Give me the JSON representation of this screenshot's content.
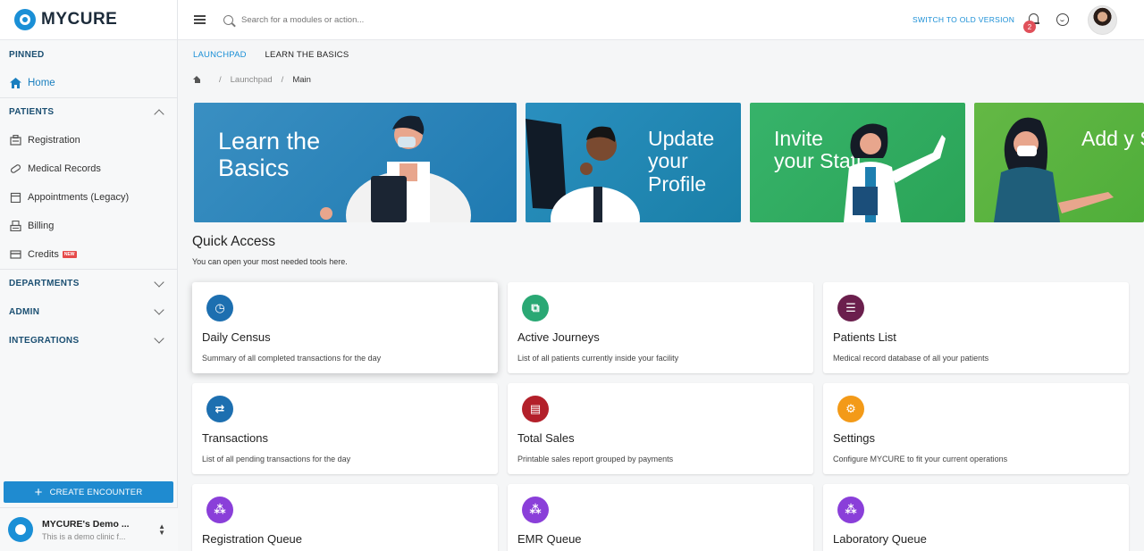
{
  "app": {
    "name": "MYCURE"
  },
  "sidebar": {
    "pinned_title": "PINNED",
    "pinned_items": [
      {
        "label": "Home",
        "icon": "home-icon"
      }
    ],
    "patients_title": "PATIENTS",
    "patients_items": [
      {
        "label": "Registration",
        "icon": "registration-icon"
      },
      {
        "label": "Medical Records",
        "icon": "pill-icon"
      },
      {
        "label": "Appointments (Legacy)",
        "icon": "calendar-icon"
      },
      {
        "label": "Billing",
        "icon": "billing-icon"
      },
      {
        "label": "Credits",
        "icon": "credit-card-icon",
        "badge": "NEW"
      }
    ],
    "departments_title": "DEPARTMENTS",
    "admin_title": "ADMIN",
    "integrations_title": "INTEGRATIONS",
    "create_button": "CREATE ENCOUNTER",
    "clinic_name": "MYCURE's Demo ...",
    "clinic_sub": "This is a demo clinic f..."
  },
  "topbar": {
    "search_placeholder": "Search for a modules or action...",
    "switch_link": "SWITCH TO OLD VERSION",
    "notification_count": "2"
  },
  "tabs": [
    {
      "label": "LAUNCHPAD"
    },
    {
      "label": "LEARN THE BASICS"
    }
  ],
  "breadcrumb": {
    "item1": "Launchpad",
    "current": "Main"
  },
  "banners": [
    {
      "text": "Learn the Basics",
      "color": "#2b86bd"
    },
    {
      "text": "Update your Profile",
      "color": "#238aba"
    },
    {
      "text": "Invite your Staff",
      "color": "#33ad62"
    },
    {
      "text": "Add y Servi",
      "color": "#5bb441"
    }
  ],
  "quick_access": {
    "title": "Quick Access",
    "subtitle": "You can open your most needed tools here.",
    "cards": [
      {
        "title": "Daily Census",
        "desc": "Summary of all completed transactions for the day",
        "icon": "census-icon",
        "color": "#1d6fb0"
      },
      {
        "title": "Active Journeys",
        "desc": "List of all patients currently inside your facility",
        "icon": "journeys-icon",
        "color": "#2aa874"
      },
      {
        "title": "Patients List",
        "desc": "Medical record database of all your patients",
        "icon": "patients-list-icon",
        "color": "#6b1f4d"
      },
      {
        "title": "Transactions",
        "desc": "List of all pending transactions for the day",
        "icon": "transactions-icon",
        "color": "#1d6fb0"
      },
      {
        "title": "Total Sales",
        "desc": "Printable sales report grouped by payments",
        "icon": "sales-icon",
        "color": "#b3202a"
      },
      {
        "title": "Settings",
        "desc": "Configure MYCURE to fit your current operations",
        "icon": "settings-icon",
        "color": "#f39a18"
      },
      {
        "title": "Registration Queue",
        "desc": "",
        "icon": "queue-icon",
        "color": "#8a3fd9"
      },
      {
        "title": "EMR Queue",
        "desc": "",
        "icon": "queue-icon",
        "color": "#8a3fd9"
      },
      {
        "title": "Laboratory Queue",
        "desc": "",
        "icon": "queue-icon",
        "color": "#8a3fd9"
      }
    ]
  }
}
